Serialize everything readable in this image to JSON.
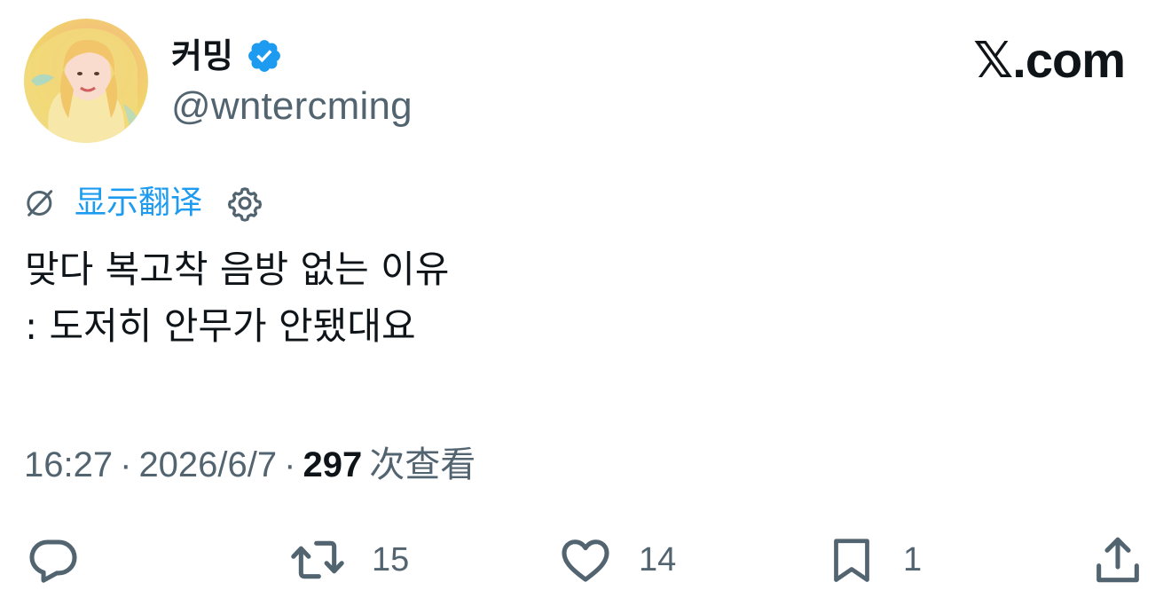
{
  "author": {
    "display_name": "커밍",
    "handle": "@wntercming",
    "verified": true,
    "avatar_icon": "profile-photo"
  },
  "site": {
    "logo_text": "𝕏.com"
  },
  "translate": {
    "label": "显示翻译",
    "icon": "globe-icon",
    "settings_icon": "gear-icon"
  },
  "tweet": {
    "lines": [
      "맞다 복고착 음방 없는 이유",
      ": 도저히 안무가 안됐대요"
    ]
  },
  "meta": {
    "time": "16:27",
    "separator": "·",
    "date": "2026/6/7",
    "views_count": "297",
    "views_label": "次查看"
  },
  "actions": {
    "reply": {
      "icon": "reply-icon"
    },
    "retweet": {
      "icon": "retweet-icon",
      "count": "15"
    },
    "like": {
      "icon": "heart-icon",
      "count": "14"
    },
    "bookmark": {
      "icon": "bookmark-icon",
      "count": "1"
    },
    "share": {
      "icon": "share-icon"
    }
  },
  "colors": {
    "accent": "#1d9bf0",
    "text": "#0f1419",
    "secondary": "#536471"
  }
}
